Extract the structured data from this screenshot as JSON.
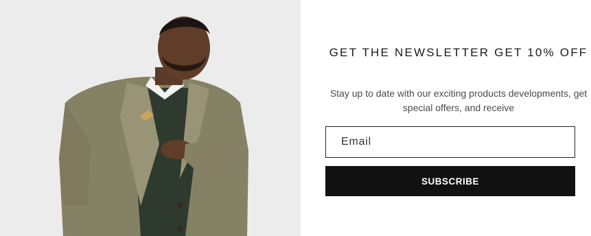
{
  "newsletter": {
    "heading": "GET THE NEWSLETTER GET 10% OFF",
    "subtext": "Stay up to date with our exciting products developments, get special offers, and receive",
    "email_placeholder": "Email",
    "subscribe_label": "SUBSCRIBE"
  },
  "colors": {
    "image_background": "#ebebeb",
    "button_background": "#111111",
    "button_text": "#ffffff"
  }
}
